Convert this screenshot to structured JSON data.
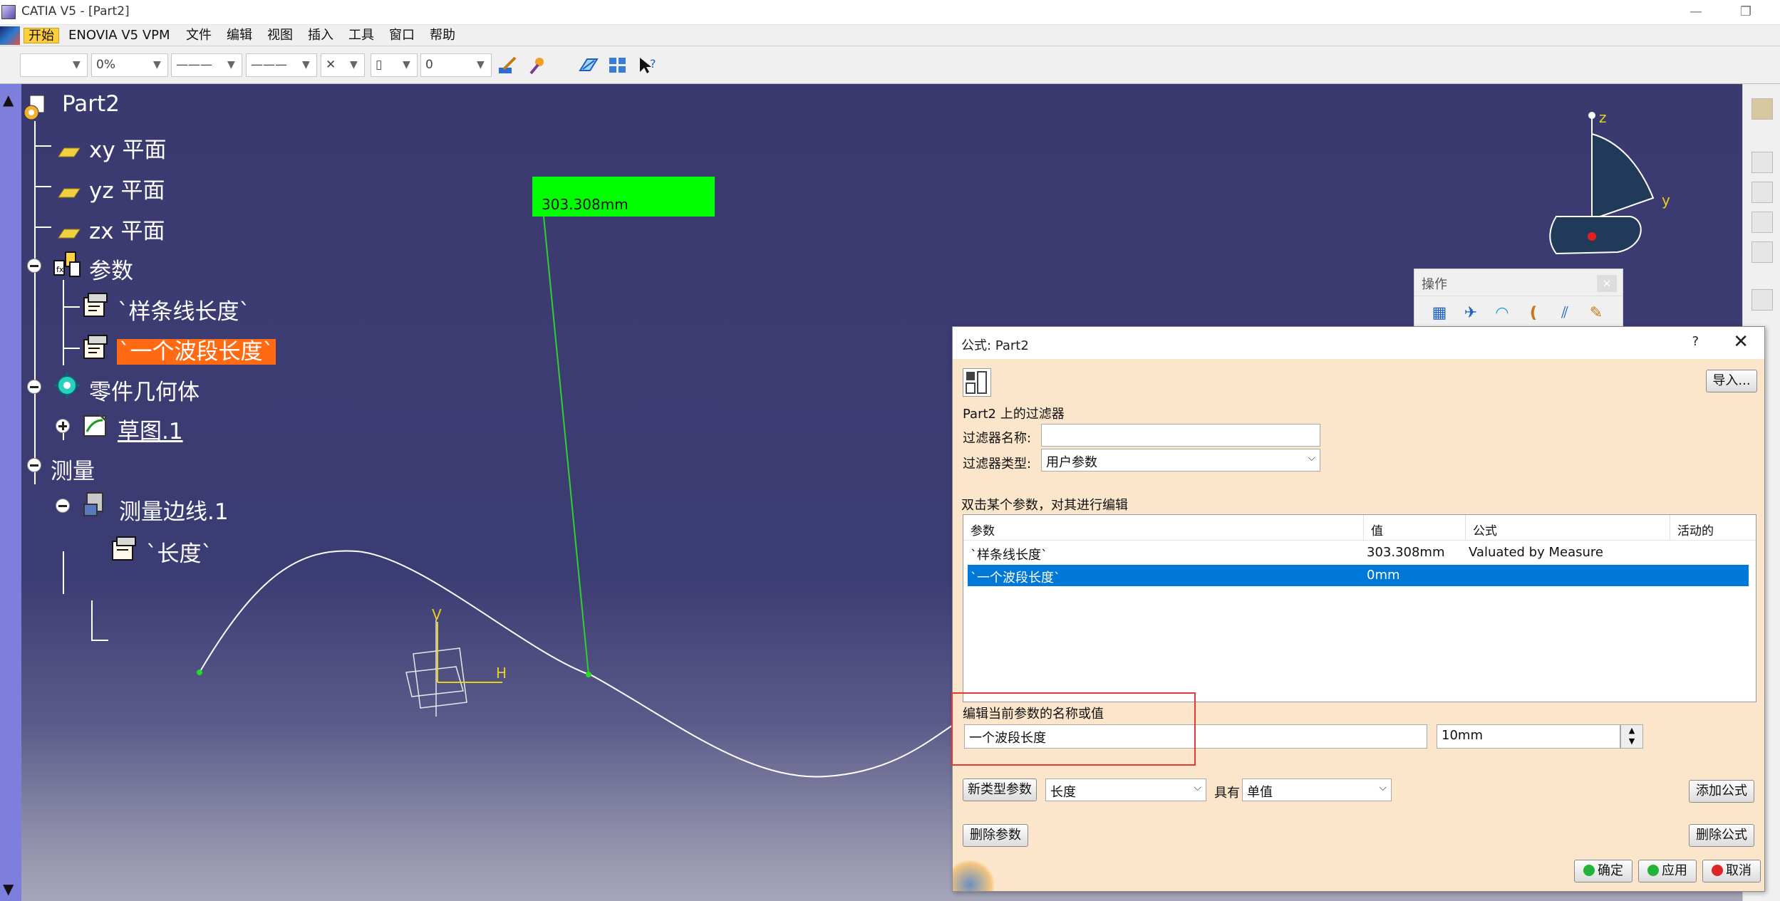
{
  "window": {
    "title": "CATIA V5 - [Part2]",
    "minimize": "—",
    "restore": "❐"
  },
  "menu": {
    "items": [
      "开始",
      "ENOVIA V5 VPM",
      "文件",
      "编辑",
      "视图",
      "插入",
      "工具",
      "窗口",
      "帮助"
    ]
  },
  "toolbar": {
    "color_value": "",
    "transparency": "0%",
    "line_type": "———",
    "line_weight": "———",
    "point_symbol": "✕",
    "layer": "0"
  },
  "tree": {
    "root": "Part2",
    "nodes": [
      {
        "label": "xy 平面"
      },
      {
        "label": "yz 平面"
      },
      {
        "label": "zx 平面"
      },
      {
        "label": "参数"
      },
      {
        "label": "`样条线长度`"
      },
      {
        "label": "`一个波段长度`"
      },
      {
        "label": "零件几何体"
      },
      {
        "label": "草图.1"
      },
      {
        "label": "测量"
      },
      {
        "label": "测量边线.1"
      },
      {
        "label": "`长度`"
      }
    ]
  },
  "viewport": {
    "measure_label": "303.308mm",
    "axis_v": "V",
    "axis_h": "H",
    "compass_z": "z",
    "compass_y": "y"
  },
  "operations": {
    "title": "操作",
    "close": "×"
  },
  "dialog": {
    "title": "公式:  Part2",
    "help": "?",
    "close": "✕",
    "import_button": "导入...",
    "filter_section": "Part2 上的过滤器",
    "filter_name_label": "过滤器名称:",
    "filter_name_value": "",
    "filter_type_label": "过滤器类型:",
    "filter_type_value": "用户参数",
    "instruction": "双击某个参数，对其进行编辑",
    "table": {
      "headers": [
        "参数",
        "值",
        "公式",
        "活动的"
      ],
      "rows": [
        {
          "param": "`样条线长度`",
          "value": "303.308mm",
          "formula": "Valuated by Measure",
          "active": ""
        },
        {
          "param": "`一个波段长度`",
          "value": "0mm",
          "formula": "",
          "active": ""
        }
      ]
    },
    "edit_label": "编辑当前参数的名称或值",
    "edit_name": "一个波段长度",
    "edit_value": "10mm",
    "new_param_button": "新类型参数",
    "new_param_type": "长度",
    "with_label": "具有",
    "with_value": "单值",
    "add_formula_button": "添加公式",
    "delete_param_button": "删除参数",
    "delete_formula_button": "删除公式",
    "ok_button": "确定",
    "apply_button": "应用",
    "cancel_button": "取消"
  }
}
